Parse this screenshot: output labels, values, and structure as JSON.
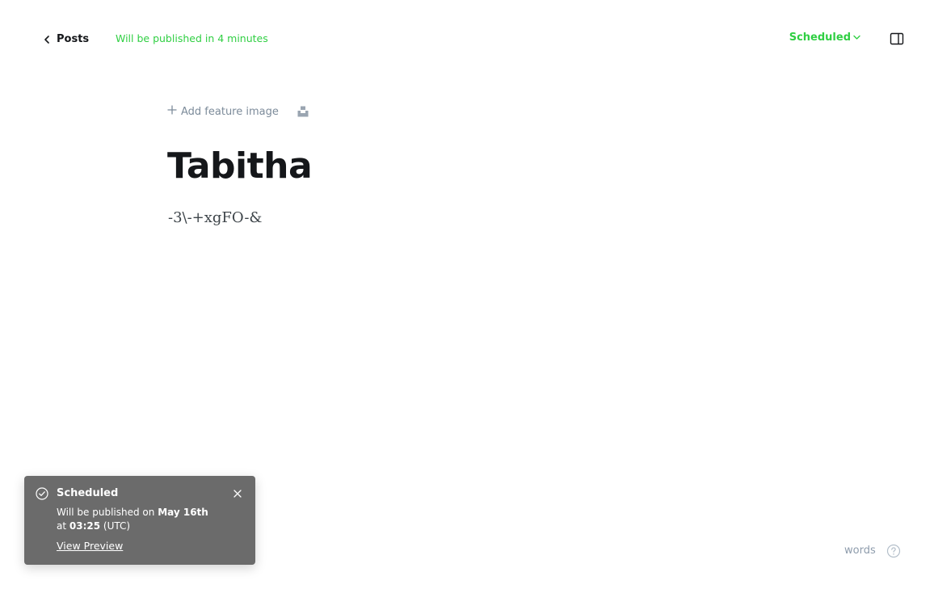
{
  "header": {
    "back_label": "Posts",
    "status_message": "Will be published in 4 minutes",
    "status_dropdown_label": "Scheduled"
  },
  "editor": {
    "add_feature_image_label": "Add feature image",
    "title": "Tabitha",
    "body": "-3\\-+xgFO-&"
  },
  "toast": {
    "title": "Scheduled",
    "line1_prefix": "Will be published on ",
    "date": "May 16th",
    "line2_prefix": "at ",
    "time": "03:25",
    "timezone": " (UTC)",
    "preview_link": "View Preview"
  },
  "footer": {
    "word_count_label": "words"
  },
  "colors": {
    "accent_green": "#30cf43",
    "toast_bg": "#6b6b6b",
    "muted_text": "#7c8b9a"
  },
  "icons": [
    "chevron-left-icon",
    "chevron-down-icon",
    "sidebar-toggle-icon",
    "plus-icon",
    "unsplash-icon",
    "check-circle-icon",
    "close-icon",
    "help-icon"
  ]
}
